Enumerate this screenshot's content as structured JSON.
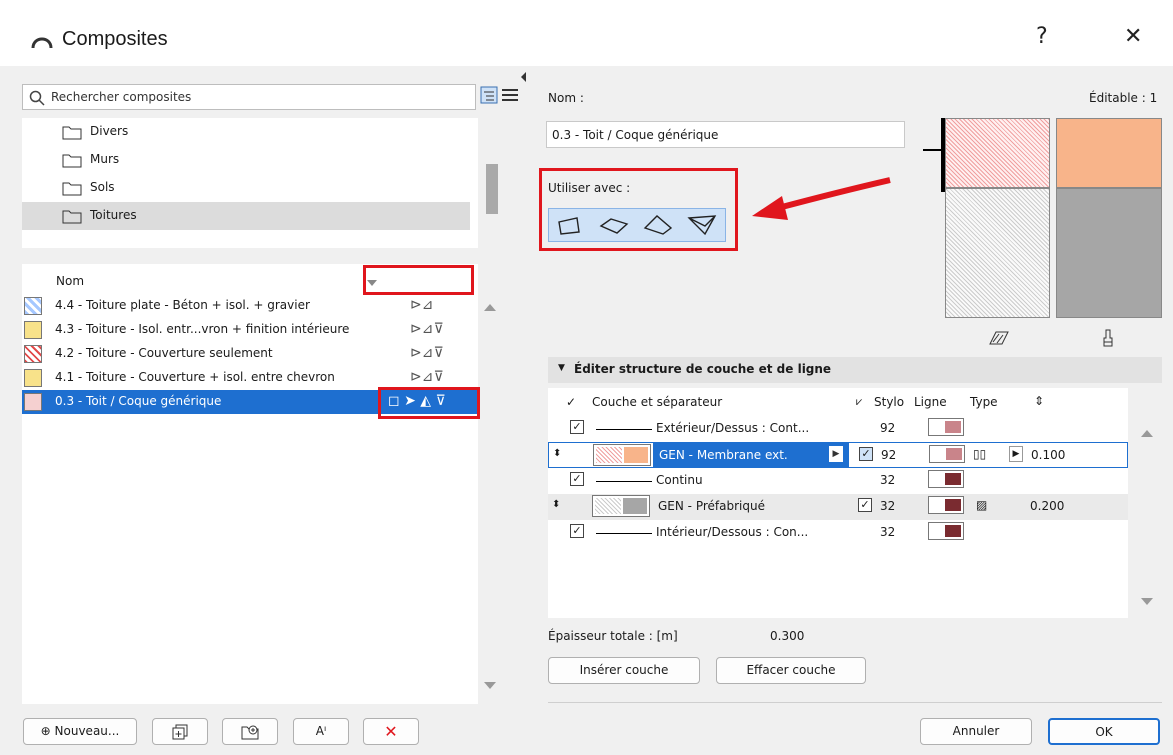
{
  "window": {
    "title": "Composites",
    "help_icon": "?",
    "close_icon": "✕"
  },
  "left": {
    "search_placeholder": "Rechercher composites",
    "folders": [
      "Divers",
      "Murs",
      "Sols",
      "Toitures"
    ],
    "list_header": "Nom",
    "rows": [
      "4.4 - Toiture plate - Béton + isol. + gravier",
      "4.3 - Toiture - Isol. entr...vron + finition intérieure",
      "4.2 - Toiture - Couverture seulement",
      "4.1 - Toiture - Couverture + isol. entre chevron",
      "0.3 - Toit / Coque générique"
    ],
    "buttons": {
      "new": "Nouveau...",
      "new_icon": "⊕",
      "delete_icon": "✕",
      "rename_icon": "Aᴵ"
    }
  },
  "right": {
    "name_label": "Nom :",
    "editable_label": "Éditable : 1",
    "name_value": "0.3 - Toit / Coque générique",
    "use_with_label": "Utiliser avec :",
    "section_title": "Éditer structure de couche et de ligne",
    "columns": {
      "layer": "Couche et séparateur",
      "pen": "Stylo",
      "line": "Ligne",
      "type": "Type"
    },
    "layers": [
      {
        "name": "Extérieur/Dessus : Cont...",
        "pen": "92",
        "thickness": ""
      },
      {
        "name": "GEN - Membrane ext.",
        "pen": "92",
        "thickness": "0.100"
      },
      {
        "name": "Continu",
        "pen": "32",
        "thickness": ""
      },
      {
        "name": "GEN - Préfabriqué",
        "pen": "32",
        "thickness": "0.200"
      },
      {
        "name": "Intérieur/Dessous : Con...",
        "pen": "32",
        "thickness": ""
      }
    ],
    "total_label": "Épaisseur totale : [m]",
    "total_value": "0.300",
    "insert_button": "Insérer couche",
    "delete_button": "Effacer couche",
    "cancel_button": "Annuler",
    "ok_button": "OK"
  },
  "colors": {
    "accent": "#1e6fd0",
    "highlight": "#e0161d",
    "membrane": "#f8b48a",
    "prefab": "#a6a6a6"
  }
}
